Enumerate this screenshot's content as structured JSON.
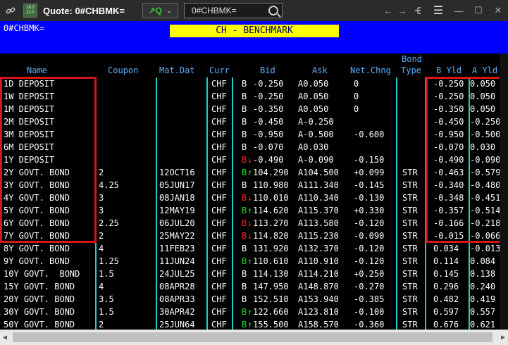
{
  "window": {
    "title": "Quote: 0#CHBMK=",
    "app_icon_lines": [
      "18.2",
      "12.0"
    ],
    "q_button_label": "Q",
    "search_value": "0#CHBMK=",
    "icons": {
      "link": "link-icon",
      "search": "search-icon",
      "back": "arrow-left-icon",
      "forward": "arrow-right-icon",
      "tree": "tree-icon",
      "menu": "hamburger-icon",
      "minimize": "minimize-icon",
      "maximize": "maximize-icon",
      "close": "close-icon"
    }
  },
  "header": {
    "ric": "0#CHBMK=",
    "banner": "CH - BENCHMARK"
  },
  "columns": {
    "name": "Name",
    "coupon": "Coupon",
    "matdat": "Mat.Dat",
    "curr": "Curr",
    "bid": "Bid",
    "ask": "Ask",
    "netchng": "Net.Chng",
    "bondtype_1": "Bond",
    "bondtype_2": "Type",
    "byld": "B Yld",
    "ayld": "A Yld"
  },
  "colors": {
    "header_bg": "#0000ff",
    "banner_bg": "#ffff00",
    "column_header_text": "#5ab3ff",
    "tick_up": "#18e018",
    "tick_down": "#ff2020",
    "highlight_box": "#d01818",
    "grid_line": "#1ed1d1"
  },
  "rows": [
    {
      "name": "1D DEPOSIT",
      "coupon": "",
      "mat": "",
      "curr": "CHF",
      "bid_prefix": "B",
      "tick": "",
      "bid": "-0.250",
      "ask": "A0.050",
      "chg": "0",
      "type": "",
      "byld": "-0.250",
      "ayld": "0.050"
    },
    {
      "name": "1W DEPOSIT",
      "coupon": "",
      "mat": "",
      "curr": "CHF",
      "bid_prefix": "B",
      "tick": "",
      "bid": "-0.250",
      "ask": "A0.050",
      "chg": "0",
      "type": "",
      "byld": "-0.250",
      "ayld": "0.050"
    },
    {
      "name": "1M DEPOSIT",
      "coupon": "",
      "mat": "",
      "curr": "CHF",
      "bid_prefix": "B",
      "tick": "",
      "bid": "-0.350",
      "ask": "A0.050",
      "chg": "0",
      "type": "",
      "byld": "-0.350",
      "ayld": "0.050"
    },
    {
      "name": "2M DEPOSIT",
      "coupon": "",
      "mat": "",
      "curr": "CHF",
      "bid_prefix": "B",
      "tick": "",
      "bid": "-0.450",
      "ask": "A-0.250",
      "chg": "",
      "type": "",
      "byld": "-0.450",
      "ayld": "-0.250"
    },
    {
      "name": "3M DEPOSIT",
      "coupon": "",
      "mat": "",
      "curr": "CHF",
      "bid_prefix": "B",
      "tick": "",
      "bid": "-0.950",
      "ask": "A-0.500",
      "chg": "-0.600",
      "type": "",
      "byld": "-0.950",
      "ayld": "-0.500"
    },
    {
      "name": "6M DEPOSIT",
      "coupon": "",
      "mat": "",
      "curr": "CHF",
      "bid_prefix": "B",
      "tick": "",
      "bid": "-0.070",
      "ask": "A0.030",
      "chg": "",
      "type": "",
      "byld": "-0.070",
      "ayld": "0.030"
    },
    {
      "name": "1Y DEPOSIT",
      "coupon": "",
      "mat": "",
      "curr": "CHF",
      "bid_prefix": "B",
      "tick": "down",
      "bid": "-0.490",
      "ask": "A-0.090",
      "chg": "-0.150",
      "type": "",
      "byld": "-0.490",
      "ayld": "-0.090"
    },
    {
      "name": "2Y GOVT. BOND",
      "coupon": "2",
      "mat": "12OCT16",
      "curr": "CHF",
      "bid_prefix": "B",
      "tick": "up",
      "bid": "104.290",
      "ask": "A104.500",
      "chg": "+0.099",
      "type": "STR",
      "byld": "-0.463",
      "ayld": "-0.579"
    },
    {
      "name": "3Y GOVT. BOND",
      "coupon": "4.25",
      "mat": "05JUN17",
      "curr": "CHF",
      "bid_prefix": "B",
      "tick": "",
      "bid": "110.980",
      "ask": "A111.340",
      "chg": "-0.145",
      "type": "STR",
      "byld": "-0.340",
      "ayld": "-0.480"
    },
    {
      "name": "4Y GOVT. BOND",
      "coupon": "3",
      "mat": "08JAN18",
      "curr": "CHF",
      "bid_prefix": "B",
      "tick": "down",
      "bid": "110.010",
      "ask": "A110.340",
      "chg": "-0.130",
      "type": "STR",
      "byld": "-0.348",
      "ayld": "-0.451"
    },
    {
      "name": "5Y GOVT. BOND",
      "coupon": "3",
      "mat": "12MAY19",
      "curr": "CHF",
      "bid_prefix": "B",
      "tick": "up",
      "bid": "114.620",
      "ask": "A115.370",
      "chg": "+0.330",
      "type": "STR",
      "byld": "-0.357",
      "ayld": "-0.514"
    },
    {
      "name": "6Y GOVT. BOND",
      "coupon": "2.25",
      "mat": "06JUL20",
      "curr": "CHF",
      "bid_prefix": "B",
      "tick": "down",
      "bid": "113.270",
      "ask": "A113.580",
      "chg": "-0.120",
      "type": "STR",
      "byld": "-0.166",
      "ayld": "-0.218"
    },
    {
      "name": "7Y GOVT. BOND",
      "coupon": "2",
      "mat": "25MAY22",
      "curr": "CHF",
      "bid_prefix": "B",
      "tick": "down",
      "bid": "114.820",
      "ask": "A115.230",
      "chg": "-0.090",
      "type": "STR",
      "byld": "-0.015",
      "ayld": "-0.066"
    },
    {
      "name": "8Y GOVT. BOND",
      "coupon": "4",
      "mat": "11FEB23",
      "curr": "CHF",
      "bid_prefix": "B",
      "tick": "",
      "bid": "131.920",
      "ask": "A132.370",
      "chg": "-0.120",
      "type": "STR",
      "byld": "0.034",
      "ayld": "-0.013"
    },
    {
      "name": "9Y GOVT. BOND",
      "coupon": "1.25",
      "mat": "11JUN24",
      "curr": "CHF",
      "bid_prefix": "B",
      "tick": "up",
      "bid": "110.610",
      "ask": "A110.910",
      "chg": "-0.120",
      "type": "STR",
      "byld": "0.114",
      "ayld": "0.084"
    },
    {
      "name": "10Y GOVT.  BOND",
      "coupon": "1.5",
      "mat": "24JUL25",
      "curr": "CHF",
      "bid_prefix": "B",
      "tick": "",
      "bid": "114.130",
      "ask": "A114.210",
      "chg": "+0.250",
      "type": "STR",
      "byld": "0.145",
      "ayld": "0.138"
    },
    {
      "name": "15Y GOVT. BOND",
      "coupon": "4",
      "mat": "08APR28",
      "curr": "CHF",
      "bid_prefix": "B",
      "tick": "",
      "bid": "147.950",
      "ask": "A148.870",
      "chg": "-0.270",
      "type": "STR",
      "byld": "0.296",
      "ayld": "0.240"
    },
    {
      "name": "20Y GOVT. BOND",
      "coupon": "3.5",
      "mat": "08APR33",
      "curr": "CHF",
      "bid_prefix": "B",
      "tick": "",
      "bid": "152.510",
      "ask": "A153.940",
      "chg": "-0.385",
      "type": "STR",
      "byld": "0.482",
      "ayld": "0.419"
    },
    {
      "name": "30Y GOVT. BOND",
      "coupon": "1.5",
      "mat": "30APR42",
      "curr": "CHF",
      "bid_prefix": "B",
      "tick": "up",
      "bid": "122.660",
      "ask": "A123.810",
      "chg": "-0.100",
      "type": "STR",
      "byld": "0.597",
      "ayld": "0.557"
    },
    {
      "name": "50Y GOVT. BOND",
      "coupon": "2",
      "mat": "25JUN64",
      "curr": "CHF",
      "bid_prefix": "B",
      "tick": "up",
      "bid": "155.500",
      "ask": "A158.570",
      "chg": "-0.360",
      "type": "STR",
      "byld": "0.676",
      "ayld": "0.621"
    }
  ]
}
